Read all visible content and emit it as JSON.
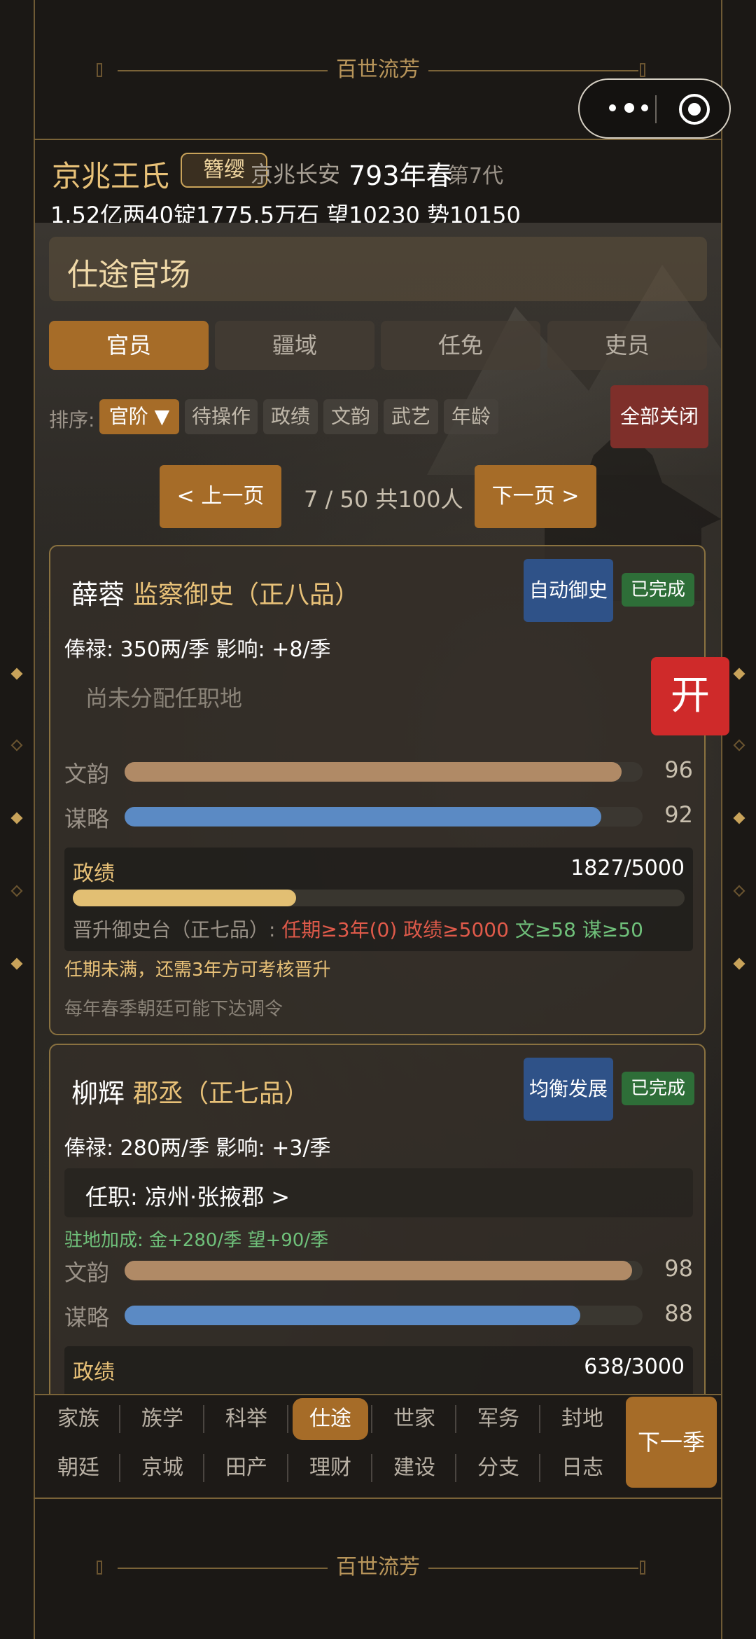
{
  "banner": {
    "title": "百世流芳"
  },
  "family": {
    "name": "京兆王氏",
    "badge": "簪缨",
    "location": "京兆长安",
    "year": "793年春",
    "generation": "第7代",
    "stats": "1.52亿两40锭1775.5万石  望10230 势10150"
  },
  "section": {
    "title": "仕途官场"
  },
  "tabs": [
    {
      "label": "官员",
      "active": true
    },
    {
      "label": "疆域",
      "active": false
    },
    {
      "label": "任免",
      "active": false
    },
    {
      "label": "吏员",
      "active": false
    }
  ],
  "sort": {
    "label": "排序:",
    "options": [
      "官阶 ▼",
      "待操作",
      "政绩",
      "文韵",
      "武艺",
      "年龄"
    ],
    "active_index": 0,
    "close_all": "全部关闭"
  },
  "pager": {
    "prev": "< 上一页",
    "info": "7 / 50  共100人",
    "next": "下一页 >"
  },
  "open_button": "开",
  "officials": [
    {
      "name": "薛蓉",
      "rank": "监察御史（正八品）",
      "mode": "自动御史",
      "status": "已完成",
      "salary": "俸禄: 350两/季   影响: +8/季",
      "post": "尚未分配任职地",
      "stats": [
        {
          "label": "文韵",
          "value": 96,
          "color": "#b08a66"
        },
        {
          "label": "谋略",
          "value": 92,
          "color": "#5b8ac4"
        }
      ],
      "gov": {
        "label": "政绩",
        "value": "1827/5000",
        "fraction": 0.3654,
        "req_base": "晋升御史台（正七品）: ",
        "req_red": "任期≥3年(0)  政绩≥5000  ",
        "req_green": "文≥58  谋≥50"
      },
      "note1": "任期未满，还需3年方可考核晋升",
      "note2": "每年春季朝廷可能下达调令"
    },
    {
      "name": "柳辉",
      "rank": "郡丞（正七品）",
      "mode": "均衡发展",
      "status": "已完成",
      "salary": "俸禄: 280两/季   影响: +3/季",
      "post": "任职: 凉州·张掖郡  >",
      "bonus": "驻地加成: 金+280/季  望+90/季",
      "stats": [
        {
          "label": "文韵",
          "value": 98,
          "color": "#b08a66"
        },
        {
          "label": "谋略",
          "value": 88,
          "color": "#5b8ac4"
        }
      ],
      "gov": {
        "label": "政绩",
        "value": "638/3000",
        "fraction": 0.2127
      }
    }
  ],
  "nav": {
    "row1": [
      "家族",
      "族学",
      "科举",
      "仕途",
      "世家",
      "军务",
      "封地"
    ],
    "row2": [
      "朝廷",
      "京城",
      "田产",
      "理财",
      "建设",
      "分支",
      "日志"
    ],
    "active": "仕途",
    "next_season": "下一季"
  }
}
